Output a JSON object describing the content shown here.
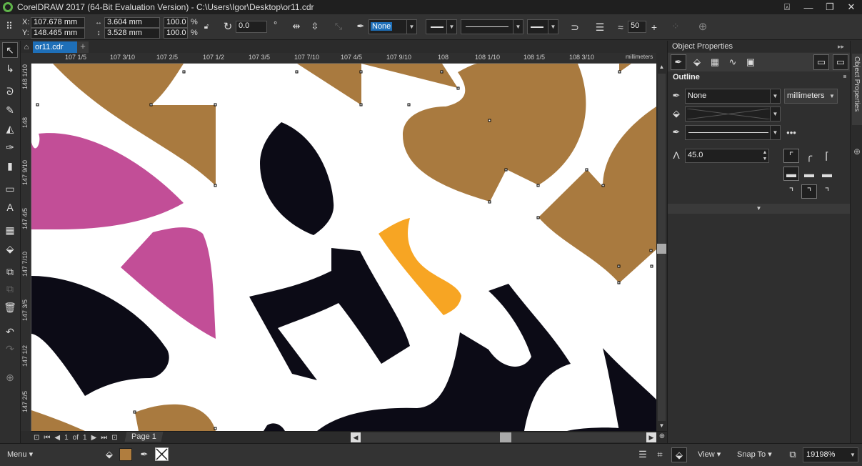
{
  "window": {
    "title": "CorelDRAW 2017 (64-Bit Evaluation Version) - C:\\Users\\Igor\\Desktop\\or11.cdr",
    "controls": [
      "minimize",
      "maximize",
      "close"
    ]
  },
  "property_bar": {
    "x_label": "X:",
    "x_value": "107.678 mm",
    "y_label": "Y:",
    "y_value": "148.465 mm",
    "width_value": "3.604 mm",
    "height_value": "3.528 mm",
    "scale_w": "100.0",
    "scale_h": "100.0",
    "percent": "%",
    "rotation": "0.0",
    "degree": "°",
    "outline_color": "None",
    "smoothing": "50"
  },
  "doc_tab": {
    "name": "or11.cdr",
    "add": "+"
  },
  "ruler": {
    "h_labels": [
      "107 1/5",
      "107 3/10",
      "107 2/5",
      "107 1/2",
      "107 3/5",
      "107 7/10",
      "107 4/5",
      "107 9/10",
      "108",
      "108 1/10",
      "108 1/5",
      "108 3/10"
    ],
    "units": "millimeters",
    "v_labels": [
      "148 1/10",
      "148",
      "147 9/10",
      "147 4/5",
      "147 7/10",
      "147 3/5",
      "147 1/2",
      "147 2/5"
    ]
  },
  "page_nav": {
    "position": "1",
    "of": "of",
    "total": "1",
    "page_tab": "Page 1"
  },
  "object_properties": {
    "title": "Object Properties",
    "section": "Outline",
    "outline_width": "None",
    "units": "millimeters",
    "miter_limit": "45.0",
    "side_tab": "Object Properties"
  },
  "status": {
    "menu": "Menu",
    "fill_swatch": "#b07d3e",
    "view": "View",
    "snap_to": "Snap To",
    "zoom": "19198%"
  },
  "colors": {
    "brown": "#a97a3f",
    "magenta": "#c24e97",
    "black": "#0c0b16",
    "orange": "#f7a523",
    "accent": "#1e6fb8"
  }
}
